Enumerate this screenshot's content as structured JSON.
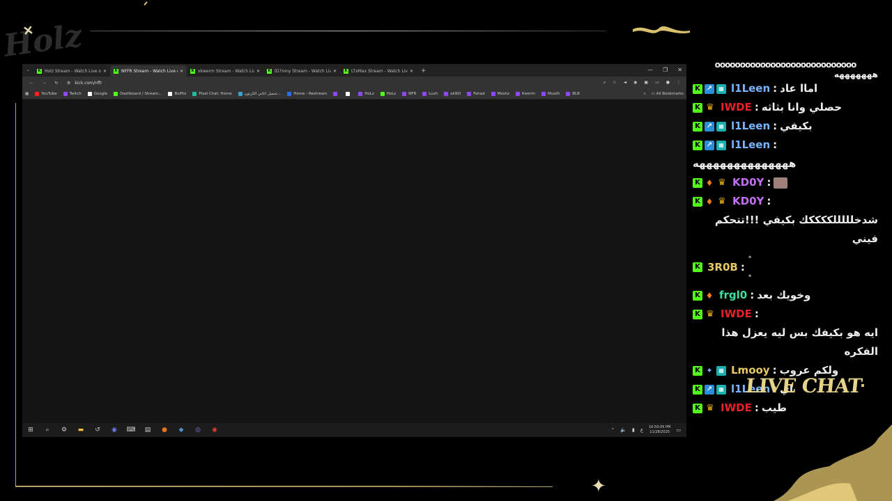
{
  "overlay": {
    "logo_text": "Holz",
    "live_chat_label": "LIVE CHAT"
  },
  "browser": {
    "tabs": [
      {
        "title": "Holz Stream - Watch Live on Ki",
        "active": false
      },
      {
        "title": "NFFR Stream - Watch Live on K",
        "active": true
      },
      {
        "title": "xkwerm Stream - Watch Live on",
        "active": false
      },
      {
        "title": "lD7mny Stream - Watch Live on",
        "active": false
      },
      {
        "title": "LTxMax Stream - Watch Live on",
        "active": false
      }
    ],
    "url": "kick.com/nffr",
    "bookmarks": [
      {
        "label": "YouTube",
        "color": "#ff2020"
      },
      {
        "label": "Twitch",
        "color": "#9146ff"
      },
      {
        "label": "Google",
        "color": "#ffffff"
      },
      {
        "label": "Dashboard / Stream...",
        "color": "#53fc18"
      },
      {
        "label": "Bolflix",
        "color": "#ffffff"
      },
      {
        "label": "Pixel Chat: Home",
        "color": "#18c0a0"
      },
      {
        "label": "تحميل اغاني الكرتون...",
        "color": "#3aa0d0"
      },
      {
        "label": "Home - Restream",
        "color": "#2a6ef0"
      },
      {
        "label": "",
        "color": "#9146ff"
      },
      {
        "label": "",
        "color": "#ffffff"
      },
      {
        "label": "HoLz",
        "color": "#9146ff"
      },
      {
        "label": "HoLz",
        "color": "#53fc18"
      },
      {
        "label": "NFR",
        "color": "#9146ff"
      },
      {
        "label": "Luzh",
        "color": "#9146ff"
      },
      {
        "label": "ak90l",
        "color": "#9146ff"
      },
      {
        "label": "Fahad",
        "color": "#9146ff"
      },
      {
        "label": "Meshz",
        "color": "#9146ff"
      },
      {
        "label": "Kwerm",
        "color": "#9146ff"
      },
      {
        "label": "Mueth",
        "color": "#9146ff"
      },
      {
        "label": "BLB",
        "color": "#9146ff"
      }
    ],
    "all_bookmarks": "All Bookmarks",
    "taskbar": {
      "time": "10:50:05 PM",
      "date": "11/28/2025",
      "lang": "ع"
    }
  },
  "chat": {
    "top_line": "هههههههه",
    "messages": [
      {
        "badges": [
          "k",
          "boost",
          "sub"
        ],
        "user": "l1Leen",
        "color": "#78b4ff",
        "text": "اماا عاد"
      },
      {
        "badges": [
          "k",
          "crown"
        ],
        "user": "IWDE",
        "color": "#e8202a",
        "text": "حصلي وانا بثاثه"
      },
      {
        "badges": [
          "k",
          "boost",
          "sub"
        ],
        "user": "l1Leen",
        "color": "#78b4ff",
        "text": "بكيفي"
      },
      {
        "badges": [
          "k",
          "boost",
          "sub"
        ],
        "user": "l1Leen",
        "color": "#78b4ff",
        "text": "ههههههههههههههه"
      },
      {
        "badges": [
          "k",
          "flame",
          "crown"
        ],
        "user": "KD0Y",
        "color": "#c070f0",
        "text": ""
      },
      {
        "badges": [
          "k",
          "flame",
          "crown"
        ],
        "user": "KD0Y",
        "color": "#c070f0",
        "text": "شدخلللللككككك بكيفي !!!تتحكم فيني"
      },
      {
        "badges": [
          "k"
        ],
        "user": "3R0B",
        "color": "#e8c860",
        "text": ""
      },
      {
        "badges": [
          "k",
          "flame"
        ],
        "user": "frgl0",
        "color": "#40e0a0",
        "text": "وخويك بعد"
      },
      {
        "badges": [
          "k",
          "crown"
        ],
        "user": "IWDE",
        "color": "#e8202a",
        "text": "ايه هو بكيفك بس ليه يعزل هذا الفكره"
      },
      {
        "badges": [
          "k",
          "mic",
          "sub"
        ],
        "user": "Lmooy",
        "color": "#e8c860",
        "text": "ولكم عروب"
      },
      {
        "badges": [
          "k",
          "boost",
          "sub"
        ],
        "user": "l1Leen",
        "color": "#78b4ff",
        "text": "اي"
      },
      {
        "badges": [
          "k",
          "crown"
        ],
        "user": "IWDE",
        "color": "#e8202a",
        "text": "طيب"
      }
    ]
  }
}
